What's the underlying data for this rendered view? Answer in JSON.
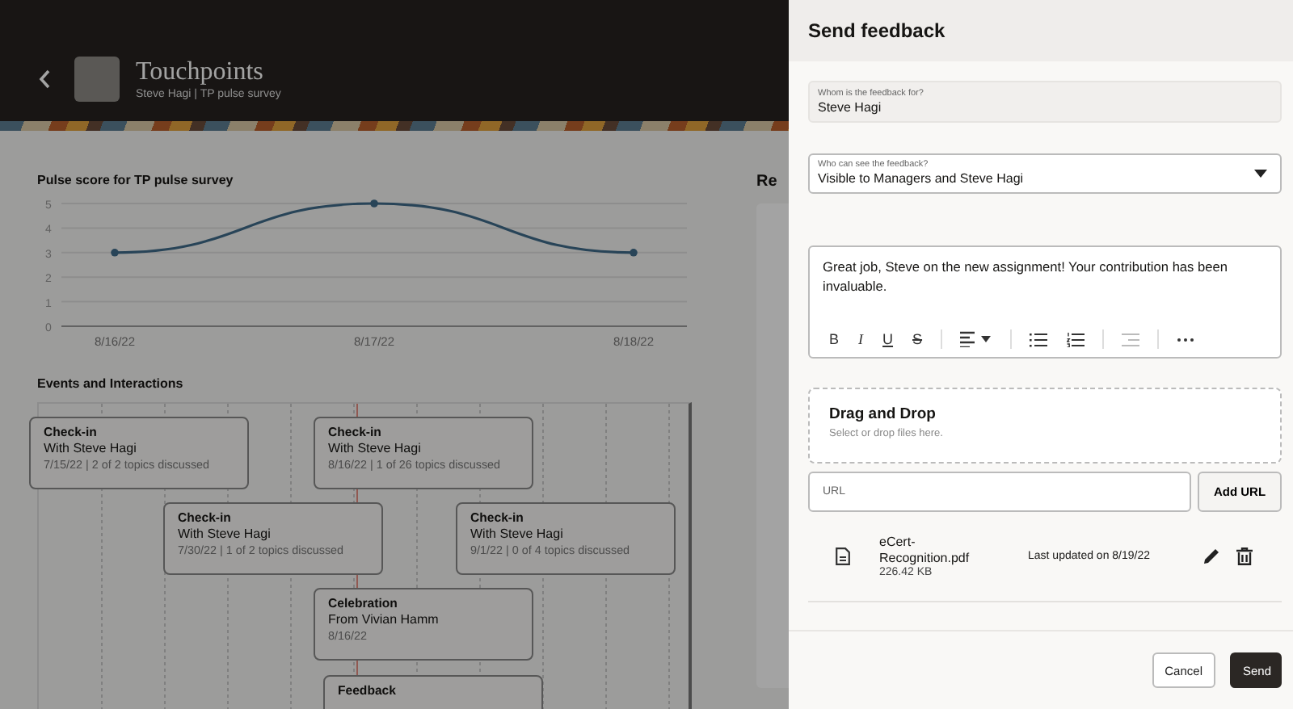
{
  "header": {
    "title": "Touchpoints",
    "subtitle": "Steve Hagi | TP pulse survey"
  },
  "pulse": {
    "title": "Pulse score for TP pulse survey",
    "chart_data": {
      "type": "line",
      "categories": [
        "8/16/22",
        "8/17/22",
        "8/18/22"
      ],
      "series": [
        {
          "color": "#3f6b8a",
          "marker": true,
          "values": [
            3,
            5,
            3
          ]
        }
      ],
      "ylim": [
        0,
        5
      ],
      "yticks": [
        0,
        1,
        2,
        3,
        4,
        5
      ],
      "grid": true
    }
  },
  "side_heading": "Re",
  "events": {
    "title": "Events and Interactions",
    "cards": [
      {
        "title": "Check-in",
        "line": "With Steve Hagi",
        "meta": "7/15/22 | 2 of 2 topics discussed"
      },
      {
        "title": "Check-in",
        "line": "With Steve Hagi",
        "meta": "8/16/22 | 1 of 26 topics discussed"
      },
      {
        "title": "Check-in",
        "line": "With Steve Hagi",
        "meta": "7/30/22 | 1 of 2 topics discussed"
      },
      {
        "title": "Check-in",
        "line": "With Steve Hagi",
        "meta": "9/1/22 | 0 of 4 topics discussed"
      },
      {
        "title": "Celebration",
        "line": "From Vivian Hamm",
        "meta": "8/16/22"
      },
      {
        "title": "Feedback"
      }
    ]
  },
  "panel": {
    "title": "Send feedback",
    "recipient": {
      "label": "Whom is the feedback for?",
      "value": "Steve Hagi"
    },
    "visibility": {
      "label": "Who can see the feedback?",
      "value": "Visible to Managers and Steve Hagi"
    },
    "message": "Great job, Steve on the new assignment! Your contribution has been invaluable.",
    "toolbar": [
      {
        "kind": "bold",
        "label": "B"
      },
      {
        "kind": "italic",
        "label": "I"
      },
      {
        "kind": "underline",
        "label": "U"
      },
      {
        "kind": "strike",
        "label": "S"
      },
      {
        "kind": "align"
      },
      {
        "kind": "bullets"
      },
      {
        "kind": "numbers"
      },
      {
        "kind": "indent",
        "disabled": true
      },
      {
        "kind": "more"
      }
    ],
    "dropzone": {
      "title": "Drag and Drop",
      "hint": "Select or drop files here."
    },
    "url": {
      "placeholder": "URL",
      "button": "Add URL"
    },
    "files": [
      {
        "name": "eCert-Recognition.pdf",
        "size": "226.42 KB",
        "updated": "Last updated on 8/19/22"
      }
    ],
    "buttons": [
      {
        "kind": "secondary",
        "label": "Cancel"
      },
      {
        "kind": "primary",
        "label": "Send"
      }
    ]
  }
}
